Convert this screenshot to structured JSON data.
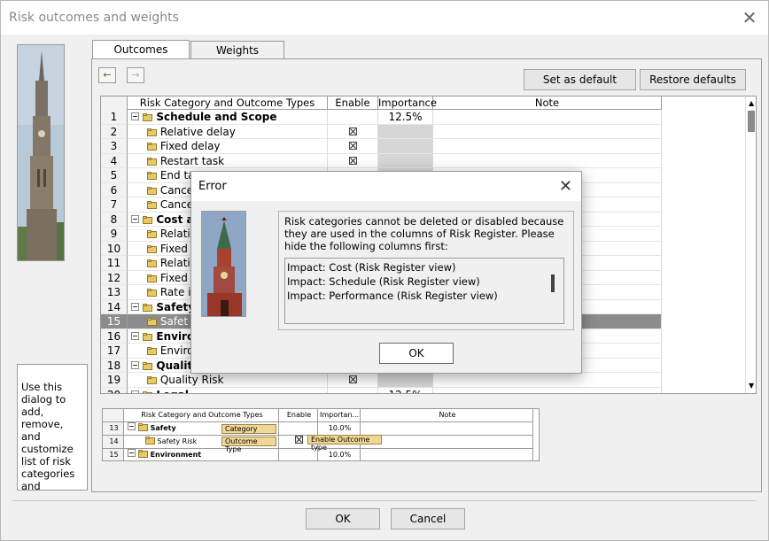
{
  "window": {
    "title": "Risk outcomes and weights",
    "close_glyph": "✕"
  },
  "help_text": "Use this dialog to add, remove, and customize list of risk categories and outcome types",
  "tabs": [
    {
      "label": "Outcomes"
    },
    {
      "label": "Weights"
    }
  ],
  "buttons": {
    "set_default": "Set as default",
    "restore_defaults": "Restore defaults",
    "ok": "OK",
    "cancel": "Cancel",
    "nav_back": "←",
    "nav_forward": "→"
  },
  "grid": {
    "headers": [
      "Risk Category and Outcome Types",
      "Enable",
      "Importance",
      "Note"
    ],
    "rows": [
      {
        "num": "1",
        "name": "Schedule and Scope",
        "type": "cat",
        "enable": "",
        "importance": "12.5%"
      },
      {
        "num": "2",
        "name": "Relative delay",
        "type": "out",
        "enable": "x",
        "importance": ""
      },
      {
        "num": "3",
        "name": "Fixed delay",
        "type": "out",
        "enable": "x",
        "importance": ""
      },
      {
        "num": "4",
        "name": "Restart task",
        "type": "out",
        "enable": "x",
        "importance": ""
      },
      {
        "num": "5",
        "name": "End ta",
        "type": "out",
        "enable": "",
        "importance": ""
      },
      {
        "num": "6",
        "name": "Cance",
        "type": "out",
        "enable": "",
        "importance": ""
      },
      {
        "num": "7",
        "name": "Cance",
        "type": "out",
        "enable": "",
        "importance": ""
      },
      {
        "num": "8",
        "name": "Cost an",
        "type": "cat",
        "enable": "",
        "importance": ""
      },
      {
        "num": "9",
        "name": "Relati",
        "type": "out",
        "enable": "",
        "importance": ""
      },
      {
        "num": "10",
        "name": "Fixed",
        "type": "out",
        "enable": "",
        "importance": ""
      },
      {
        "num": "11",
        "name": "Relati",
        "type": "out",
        "enable": "",
        "importance": ""
      },
      {
        "num": "12",
        "name": "Fixed",
        "type": "out",
        "enable": "",
        "importance": ""
      },
      {
        "num": "13",
        "name": "Rate i",
        "type": "out",
        "enable": "",
        "importance": ""
      },
      {
        "num": "14",
        "name": "Safety",
        "type": "cat",
        "enable": "",
        "importance": ""
      },
      {
        "num": "15",
        "name": "Safet",
        "type": "sel",
        "enable": "",
        "importance": ""
      },
      {
        "num": "16",
        "name": "Enviror",
        "type": "cat",
        "enable": "",
        "importance": ""
      },
      {
        "num": "17",
        "name": "Enviro",
        "type": "out",
        "enable": "",
        "importance": ""
      },
      {
        "num": "18",
        "name": "Quality",
        "type": "cat",
        "enable": "",
        "importance": ""
      },
      {
        "num": "19",
        "name": "Quality Risk",
        "type": "out",
        "enable": "x",
        "importance": ""
      },
      {
        "num": "20",
        "name": "Legal",
        "type": "cat",
        "enable": "",
        "importance": "12.5%"
      }
    ]
  },
  "mini": {
    "headers": [
      "Risk Category and Outcome Types",
      "Enable",
      "Importan...",
      "Note"
    ],
    "rows": [
      {
        "num": "13",
        "name": "Safety",
        "type": "cat",
        "enable": "",
        "importance": "10.0%"
      },
      {
        "num": "14",
        "name": "Safety Risk",
        "type": "out",
        "enable": "x",
        "importance": ""
      },
      {
        "num": "15",
        "name": "Environment",
        "type": "cat",
        "enable": "",
        "importance": "10.0%"
      }
    ],
    "callouts": {
      "category": "Category",
      "outcome_type": "Outcome Type",
      "enable": "Enable Outcome type"
    }
  },
  "error_dialog": {
    "title": "Error",
    "message": "Risk categories cannot be deleted or disabled because they are used in the columns of Risk Register. Please hide the following columns first:",
    "items": [
      "Impact: Cost (Risk Register view)",
      "Impact: Schedule (Risk Register view)",
      "Impact: Performance (Risk Register view)"
    ],
    "ok": "OK"
  },
  "colors": {
    "selected_row": "#8c8c8c",
    "callout": "#f0d796",
    "folder": "#e8c96a"
  }
}
